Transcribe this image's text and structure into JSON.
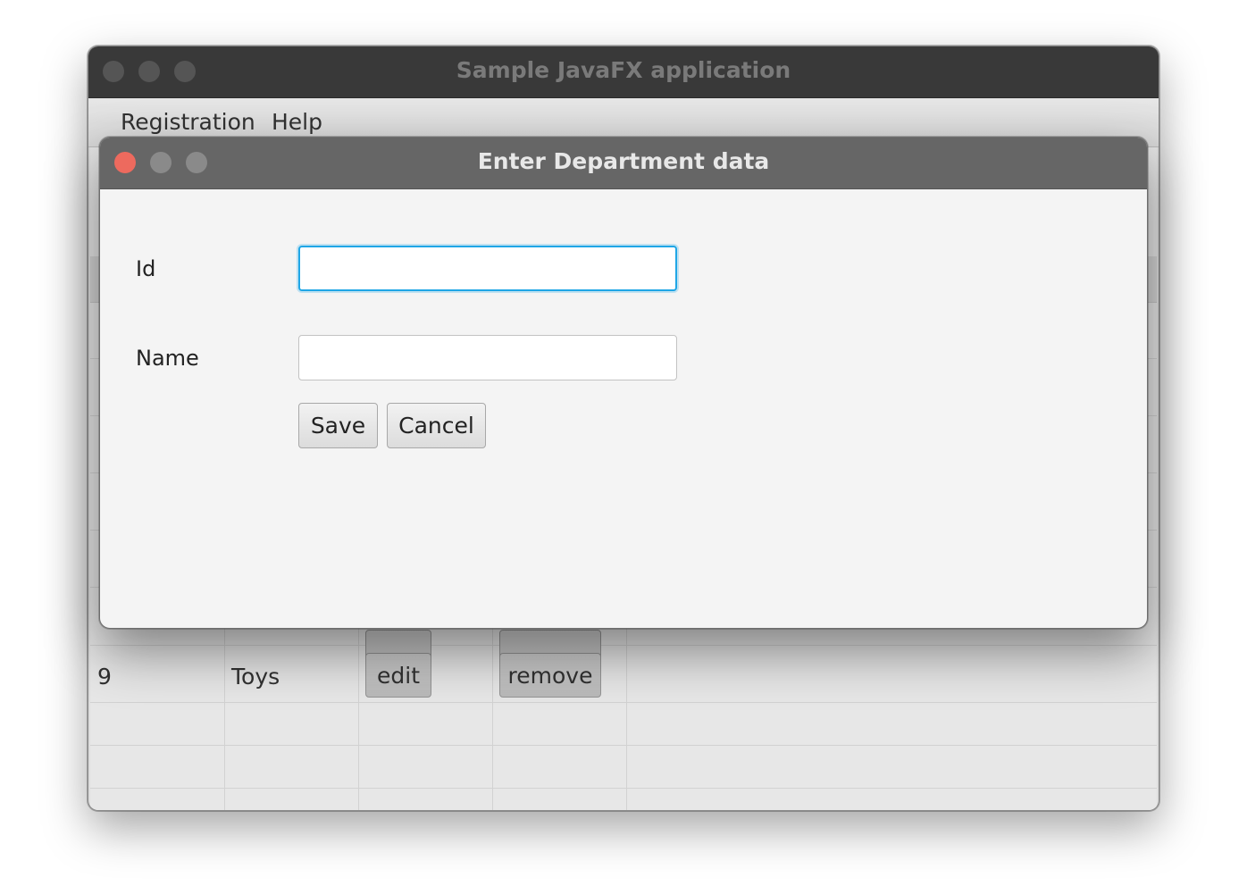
{
  "main_window": {
    "title": "Sample JavaFX application",
    "menu": [
      "Registration",
      "Help"
    ]
  },
  "table": {
    "visible_rows": [
      {
        "id": "9",
        "name": "Toys",
        "edit_label": "edit",
        "remove_label": "remove"
      }
    ]
  },
  "dialog": {
    "title": "Enter Department data",
    "fields": {
      "id_label": "Id",
      "id_value": "",
      "name_label": "Name",
      "name_value": ""
    },
    "buttons": {
      "save": "Save",
      "cancel": "Cancel"
    }
  },
  "colors": {
    "close_button": "#ed6a5e",
    "focus_ring": "#1fa6e6"
  }
}
